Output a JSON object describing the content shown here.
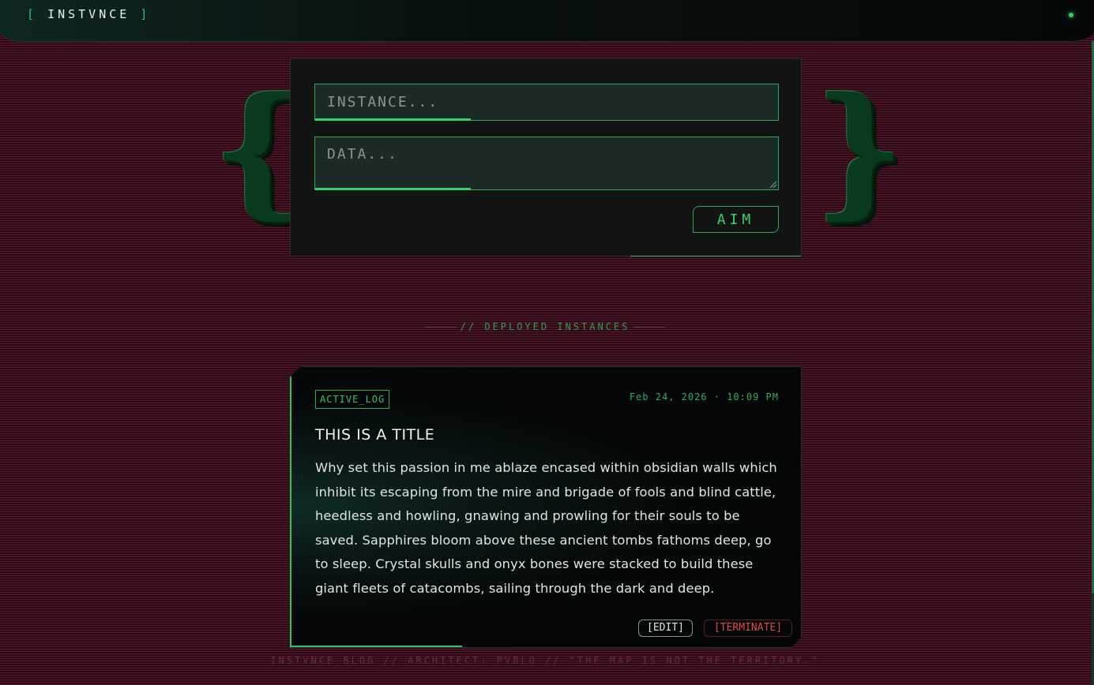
{
  "header": {
    "brand_open": "[",
    "brand": "INSTVNCE",
    "brand_close": "]"
  },
  "form": {
    "instance_placeholder": "INSTANCE...",
    "data_placeholder": "DATA...",
    "submit_label": "AIM"
  },
  "section": {
    "label": "// DEPLOYED INSTANCES"
  },
  "post": {
    "tag": "ACTIVE_LOG",
    "timestamp": "Feb 24, 2026 · 10:09 PM",
    "title": "THIS IS A TITLE",
    "body": "Why set this passion in me ablaze encased within obsidian walls which inhibit its escaping from the mire and brigade of fools and blind cattle, heedless and howling, gnawing and prowling for their souls to be saved. Sapphires bloom above these ancient tombs fathoms deep, go to sleep. Crystal skulls and onyx bones were stacked to build these giant fleets of catacombs, sailing through the dark and deep.",
    "edit_label": "[EDIT]",
    "terminate_label": "[TERMINATE]"
  },
  "footer": {
    "text": "INSTVNCE_BLOG // ARCHITECT: PVBLO // \"THE MAP IS NOT THE TERRITORY.\""
  },
  "colors": {
    "accent": "#2fc46a",
    "danger": "#e04848",
    "background": "#4a1324"
  }
}
